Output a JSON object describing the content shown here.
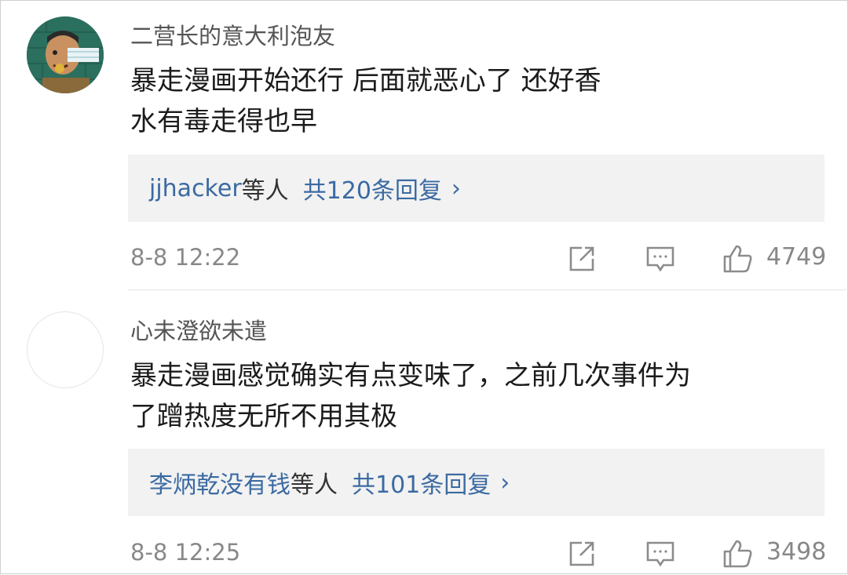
{
  "comments": [
    {
      "username": "二营长的意大利泡友",
      "text": "暴走漫画开始还行  后面就恶心了  还好香\n水有毒走得也早",
      "reply_users": "jjhacker",
      "reply_suffix": "等人",
      "reply_count": "共120条回复",
      "reply_arrow": "›",
      "time": "8-8 12:22",
      "likes": "4749"
    },
    {
      "username": "心未澄欲未遣",
      "text": "暴走漫画感觉确实有点变味了，之前几次事件为\n了蹭热度无所不用其极",
      "reply_users": "李炳乾没有钱",
      "reply_suffix": "等人",
      "reply_count": "共101条回复",
      "reply_arrow": "›",
      "time": "8-8 12:25",
      "likes": "3498"
    }
  ],
  "colors": {
    "link": "#3b6aa2",
    "meta": "#888888",
    "reply_bg": "#f2f2f2"
  },
  "icons": [
    "share-icon",
    "comment-icon",
    "like-icon"
  ]
}
